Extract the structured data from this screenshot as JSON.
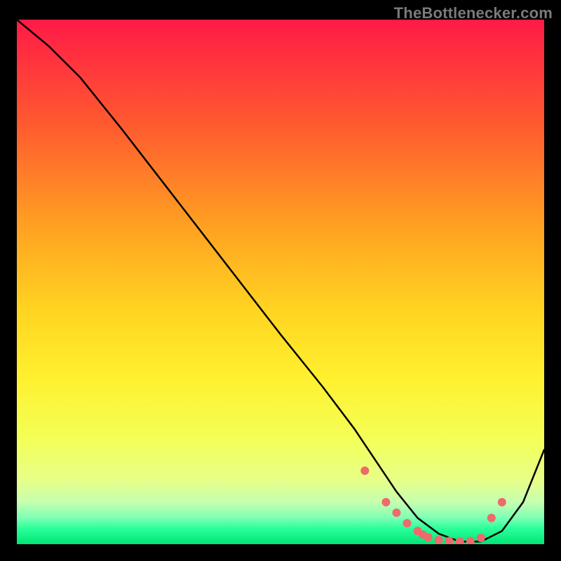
{
  "attribution": "TheBottlenecker.com",
  "chart_data": {
    "type": "line",
    "title": "",
    "xlabel": "",
    "ylabel": "",
    "xlim": [
      0,
      100
    ],
    "ylim": [
      0,
      100
    ],
    "background_gradient": {
      "stops": [
        {
          "offset": 0,
          "color": "#ff1a47"
        },
        {
          "offset": 20,
          "color": "#ff5a2f"
        },
        {
          "offset": 40,
          "color": "#ffa321"
        },
        {
          "offset": 55,
          "color": "#ffd321"
        },
        {
          "offset": 68,
          "color": "#fff02e"
        },
        {
          "offset": 80,
          "color": "#f4ff57"
        },
        {
          "offset": 88,
          "color": "#e6ff8a"
        },
        {
          "offset": 92,
          "color": "#c6ffb0"
        },
        {
          "offset": 95,
          "color": "#7dffb4"
        },
        {
          "offset": 97,
          "color": "#2aff9a"
        },
        {
          "offset": 100,
          "color": "#00e676"
        }
      ]
    },
    "series": [
      {
        "name": "bottleneck-curve",
        "color": "#000000",
        "width": 2.5,
        "x": [
          0,
          6,
          12,
          20,
          30,
          40,
          50,
          58,
          64,
          68,
          72,
          76,
          80,
          84,
          88,
          92,
          96,
          100
        ],
        "y": [
          100,
          95,
          89,
          79,
          66,
          53,
          40,
          30,
          22,
          16,
          10,
          5,
          2,
          0.5,
          0.5,
          2.5,
          8,
          18
        ]
      }
    ],
    "markers": {
      "name": "selected-points",
      "color": "#ef6a6a",
      "radius": 6,
      "x": [
        66,
        70,
        72,
        74,
        76,
        77,
        78,
        80,
        82,
        84,
        86,
        88,
        90,
        92
      ],
      "y": [
        14,
        8,
        6,
        4,
        2.5,
        1.8,
        1.3,
        0.8,
        0.6,
        0.5,
        0.6,
        1.2,
        5,
        8
      ]
    }
  }
}
